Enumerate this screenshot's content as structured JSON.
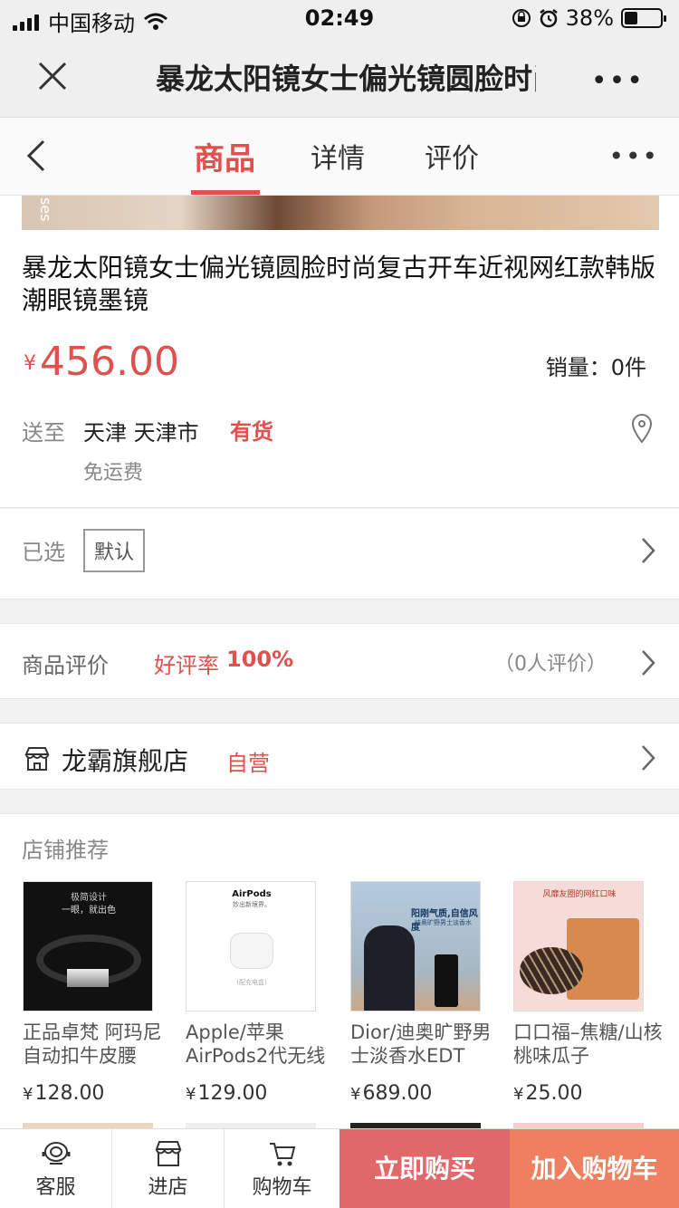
{
  "status_bar": {
    "carrier": "中国移动",
    "time": "02:49",
    "battery": "38%",
    "battery_level": 0.38
  },
  "title_bar": {
    "title": "暴龙太阳镜女士偏光镜圆脸时尚复古开车近视网红款韩版潮眼镜墨镜",
    "more": "•••"
  },
  "tabs": {
    "items": [
      "商品",
      "详情",
      "评价"
    ],
    "active": "商品",
    "more": "•••"
  },
  "hero": {
    "overlay_text": "ses"
  },
  "product": {
    "name": "暴龙太阳镜女士偏光镜圆脸时尚复古开车近视网红款韩版潮眼镜墨镜",
    "currency": "¥",
    "price": "456.00",
    "sales": "销量：0件",
    "ship_label": "送至",
    "ship_city": "天津 天津市",
    "stock": "有货",
    "shipping": "免运费"
  },
  "selection": {
    "label": "已选",
    "value": "默认"
  },
  "reviews": {
    "label": "商品评价",
    "rate_label": "好评率",
    "rate": "100%",
    "count": "（0人评价）"
  },
  "shop": {
    "name": "龙霸旗舰店",
    "badge": "自营"
  },
  "recommend": {
    "heading": "店铺推荐",
    "items": [
      {
        "title": "正品卓梵 阿玛尼自动扣牛皮腰",
        "currency": "¥",
        "price": "128.00",
        "img_text": [
          "极简设计",
          "一眼，就出色"
        ]
      },
      {
        "title": "Apple/苹果 AirPods2代无线",
        "currency": "¥",
        "price": "129.00",
        "img_text": [
          "AirPods",
          "妙出新境界。",
          "(配充电盒)"
        ]
      },
      {
        "title": "Dior/迪奥旷野男士淡香水EDT",
        "currency": "¥",
        "price": "689.00",
        "img_text": [
          "阳刚气质,自信风度",
          "迪奥旷野男士淡香水"
        ]
      },
      {
        "title": "口口福–焦糖/山核桃味瓜子",
        "currency": "¥",
        "price": "25.00",
        "img_text": [
          "风靡友圈的网红口味"
        ]
      }
    ]
  },
  "bottom_bar": {
    "service": "客服",
    "store": "进店",
    "cart": "购物车",
    "buy_now": "立即购买",
    "add_to_cart": "加入购物车"
  },
  "colors": {
    "accent": "#e0504e",
    "buy": "#e06868",
    "add_cart": "#ee7f5f"
  }
}
